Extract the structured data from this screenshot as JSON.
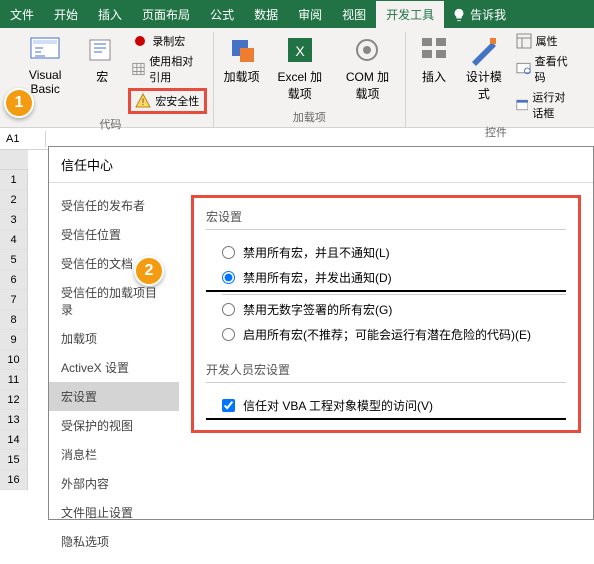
{
  "tabs": {
    "file": "文件",
    "home": "开始",
    "insert": "插入",
    "layout": "页面布局",
    "formula": "公式",
    "data": "数据",
    "review": "审阅",
    "view": "视图",
    "dev": "开发工具",
    "tell_me": "告诉我"
  },
  "ribbon": {
    "code": {
      "vb": "Visual Basic",
      "macro": "宏",
      "record": "录制宏",
      "relative": "使用相对引用",
      "security": "宏安全性",
      "group": "代码"
    },
    "addins": {
      "addin": "加载项",
      "excel": "Excel 加载项",
      "com": "COM 加载项",
      "group": "加载项"
    },
    "controls": {
      "insert": "插入",
      "design": "设计模式",
      "props": "属性",
      "viewcode": "查看代码",
      "rundialog": "运行对话框",
      "group": "控件"
    }
  },
  "namebox": "A1",
  "badges": {
    "one": "1",
    "two": "2"
  },
  "trust": {
    "title": "信任中心",
    "nav": {
      "publishers": "受信任的发布者",
      "locations": "受信任位置",
      "docs": "受信任的文档",
      "catalogs": "受信任的加载项目录",
      "addins": "加载项",
      "activex": "ActiveX 设置",
      "macros": "宏设置",
      "protected": "受保护的视图",
      "msgbar": "消息栏",
      "external": "外部内容",
      "fileblock": "文件阻止设置",
      "privacy": "隐私选项"
    },
    "macro_section": "宏设置",
    "opt1": "禁用所有宏，并且不通知(L)",
    "opt2": "禁用所有宏，并发出通知(D)",
    "opt3": "禁用无数字签署的所有宏(G)",
    "opt4": "启用所有宏(不推荐；可能会运行有潜在危险的代码)(E)",
    "dev_section": "开发人员宏设置",
    "trust_vba": "信任对 VBA 工程对象模型的访问(V)"
  }
}
